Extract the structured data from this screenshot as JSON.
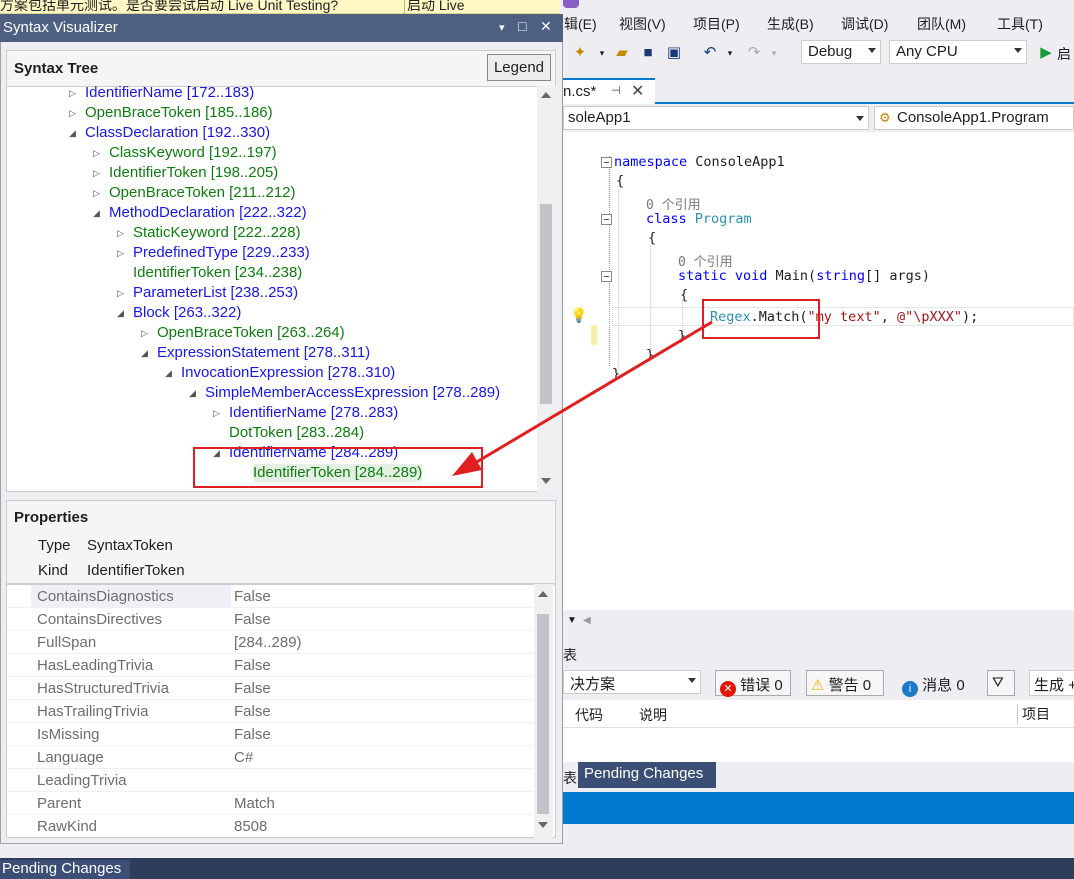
{
  "info_bar": {
    "message": "方案包括单元测试。是否要尝试启动 Live Unit Testing?",
    "start_button": "启动 Live"
  },
  "menu": [
    "辑(E)",
    "视图(V)",
    "项目(P)",
    "生成(B)",
    "调试(D)",
    "团队(M)",
    "工具(T)"
  ],
  "toolbar": {
    "config": "Debug",
    "platform": "Any CPU",
    "start_label": "启"
  },
  "document_tab": {
    "name": "n.cs*",
    "pin": "⊣",
    "close": "✕"
  },
  "nav_bar": {
    "project": "soleApp1",
    "class": "ConsoleApp1.Program"
  },
  "code": {
    "line1_kw": "namespace",
    "line1_name": " ConsoleApp1",
    "line2": "{",
    "ref1": "0 个引用",
    "line3_kw": "class",
    "line3_name": " Program",
    "line4": "{",
    "ref2": "0 个引用",
    "line5_kw1": "static",
    "line5_kw2": " void",
    "line5_rest": " Main(",
    "line5_kw3": "string",
    "line5_end": "[] args)",
    "line6": "{",
    "line7_type": "Regex",
    "line7_method": ".Match(",
    "line7_str1": "\"my text\"",
    "line7_sep": ", ",
    "line7_str2": "@\"\\pXXX\"",
    "line7_end": ");",
    "line8": "}",
    "line9": "}",
    "line10": "}"
  },
  "error_list": {
    "scope": "决方案",
    "errors": "错误 0",
    "warnings": "警告 0",
    "messages": "消息 0",
    "build": "生成 +",
    "columns": {
      "code": "代码",
      "desc": "说明",
      "project": "项目"
    },
    "title_fragment": "表"
  },
  "bottom_tabs": {
    "left_fragment": "表",
    "pending_changes": "Pending Changes",
    "bottom_pending": "Pending Changes"
  },
  "syntax_visualizer": {
    "title": "Syntax Visualizer",
    "title_controls": {
      "dropdown": "▾",
      "maximize": "□",
      "close": "✕"
    },
    "tree_header": "Syntax Tree",
    "legend": "Legend",
    "tree_nodes": [
      {
        "label": "IdentifierName [172..183)",
        "color": "blue",
        "tri": "▷",
        "indent": 0
      },
      {
        "label": "OpenBraceToken [185..186)",
        "color": "green",
        "tri": "▷",
        "indent": 0
      },
      {
        "label": "ClassDeclaration [192..330)",
        "color": "blue",
        "tri": "◢",
        "indent": 0
      },
      {
        "label": "ClassKeyword [192..197)",
        "color": "green",
        "tri": "▷",
        "indent": 1
      },
      {
        "label": "IdentifierToken [198..205)",
        "color": "green",
        "tri": "▷",
        "indent": 1
      },
      {
        "label": "OpenBraceToken [211..212)",
        "color": "green",
        "tri": "▷",
        "indent": 1
      },
      {
        "label": "MethodDeclaration [222..322)",
        "color": "blue",
        "tri": "◢",
        "indent": 1
      },
      {
        "label": "StaticKeyword [222..228)",
        "color": "green",
        "tri": "▷",
        "indent": 2
      },
      {
        "label": "PredefinedType [229..233)",
        "color": "blue",
        "tri": "▷",
        "indent": 2
      },
      {
        "label": "IdentifierToken [234..238)",
        "color": "green",
        "tri": "",
        "indent": 2
      },
      {
        "label": "ParameterList [238..253)",
        "color": "blue",
        "tri": "▷",
        "indent": 2
      },
      {
        "label": "Block [263..322)",
        "color": "blue",
        "tri": "◢",
        "indent": 2
      },
      {
        "label": "OpenBraceToken [263..264)",
        "color": "green",
        "tri": "▷",
        "indent": 3
      },
      {
        "label": "ExpressionStatement [278..311)",
        "color": "blue",
        "tri": "◢",
        "indent": 3
      },
      {
        "label": "InvocationExpression [278..310)",
        "color": "blue",
        "tri": "◢",
        "indent": 4
      },
      {
        "label": "SimpleMemberAccessExpression [278..289)",
        "color": "blue",
        "tri": "◢",
        "indent": 5
      },
      {
        "label": "IdentifierName [278..283)",
        "color": "blue",
        "tri": "▷",
        "indent": 6
      },
      {
        "label": "DotToken [283..284)",
        "color": "green",
        "tri": "",
        "indent": 6
      },
      {
        "label": "IdentifierName [284..289)",
        "color": "blue",
        "tri": "◢",
        "indent": 6
      },
      {
        "label": "IdentifierToken [284..289)",
        "color": "green",
        "tri": "",
        "indent": 7,
        "selected": true
      }
    ],
    "properties_header": "Properties",
    "type_label": "Type",
    "type_value": "SyntaxToken",
    "kind_label": "Kind",
    "kind_value": "IdentifierToken",
    "properties": [
      {
        "name": "ContainsDiagnostics",
        "value": "False"
      },
      {
        "name": "ContainsDirectives",
        "value": "False"
      },
      {
        "name": "FullSpan",
        "value": "[284..289)"
      },
      {
        "name": "HasLeadingTrivia",
        "value": "False"
      },
      {
        "name": "HasStructuredTrivia",
        "value": "False"
      },
      {
        "name": "HasTrailingTrivia",
        "value": "False"
      },
      {
        "name": "IsMissing",
        "value": "False"
      },
      {
        "name": "Language",
        "value": "C#"
      },
      {
        "name": "LeadingTrivia",
        "value": ""
      },
      {
        "name": "Parent",
        "value": "Match"
      },
      {
        "name": "RawKind",
        "value": "8508"
      }
    ]
  },
  "colors": {
    "title_bar": "#4d6082",
    "node_blue": "#1717e6",
    "node_green": "#0e7c0e",
    "annotation_red": "#e02020",
    "accent": "#007acc"
  }
}
